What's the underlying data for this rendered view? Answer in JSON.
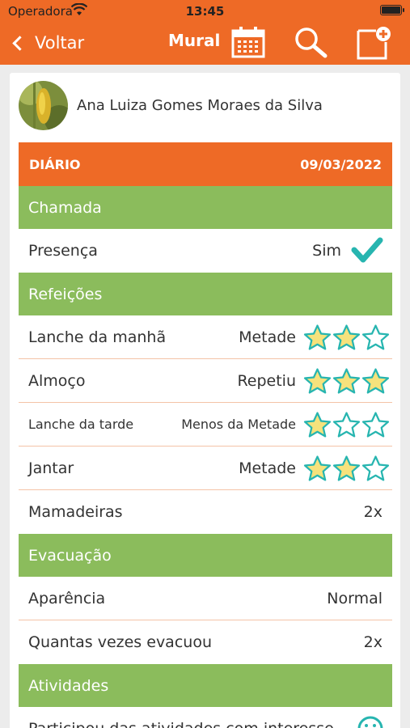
{
  "status_bar": {
    "carrier": "Operadora",
    "time": "13:45"
  },
  "nav": {
    "back_label": "Voltar",
    "title": "Mural"
  },
  "student": {
    "name": "Ana Luiza Gomes Moraes da Silva"
  },
  "diary": {
    "label": "DIÁRIO",
    "date": "09/03/2022"
  },
  "sections": {
    "chamada": {
      "title": "Chamada",
      "presence_label": "Presença",
      "presence_value": "Sim"
    },
    "refeicoes": {
      "title": "Refeições",
      "items": [
        {
          "label": "Lanche da manhã",
          "value": "Metade",
          "rating": 2
        },
        {
          "label": "Almoço",
          "value": "Repetiu",
          "rating": 3
        },
        {
          "label": "Lanche da tarde",
          "value": "Menos da Metade",
          "rating": 1
        },
        {
          "label": "Jantar",
          "value": "Metade",
          "rating": 2
        }
      ],
      "bottles_label": "Mamadeiras",
      "bottles_value": "2x"
    },
    "evacuacao": {
      "title": "Evacuação",
      "appearance_label": "Aparência",
      "appearance_value": "Normal",
      "count_label": "Quantas vezes evacuou",
      "count_value": "2x"
    },
    "atividades": {
      "title": "Atividades",
      "item_label": "Participou das atividades com interesse"
    }
  },
  "colors": {
    "brand": "#ee6a26",
    "section": "#8bbc5c",
    "check": "#27b5b0",
    "star_fill": "#f6e27c",
    "star_stroke": "#27b5b0"
  },
  "icons": [
    "chevron-left-icon",
    "calendar-icon",
    "search-icon",
    "new-post-icon",
    "check-icon",
    "star-icon",
    "smiley-icon"
  ]
}
